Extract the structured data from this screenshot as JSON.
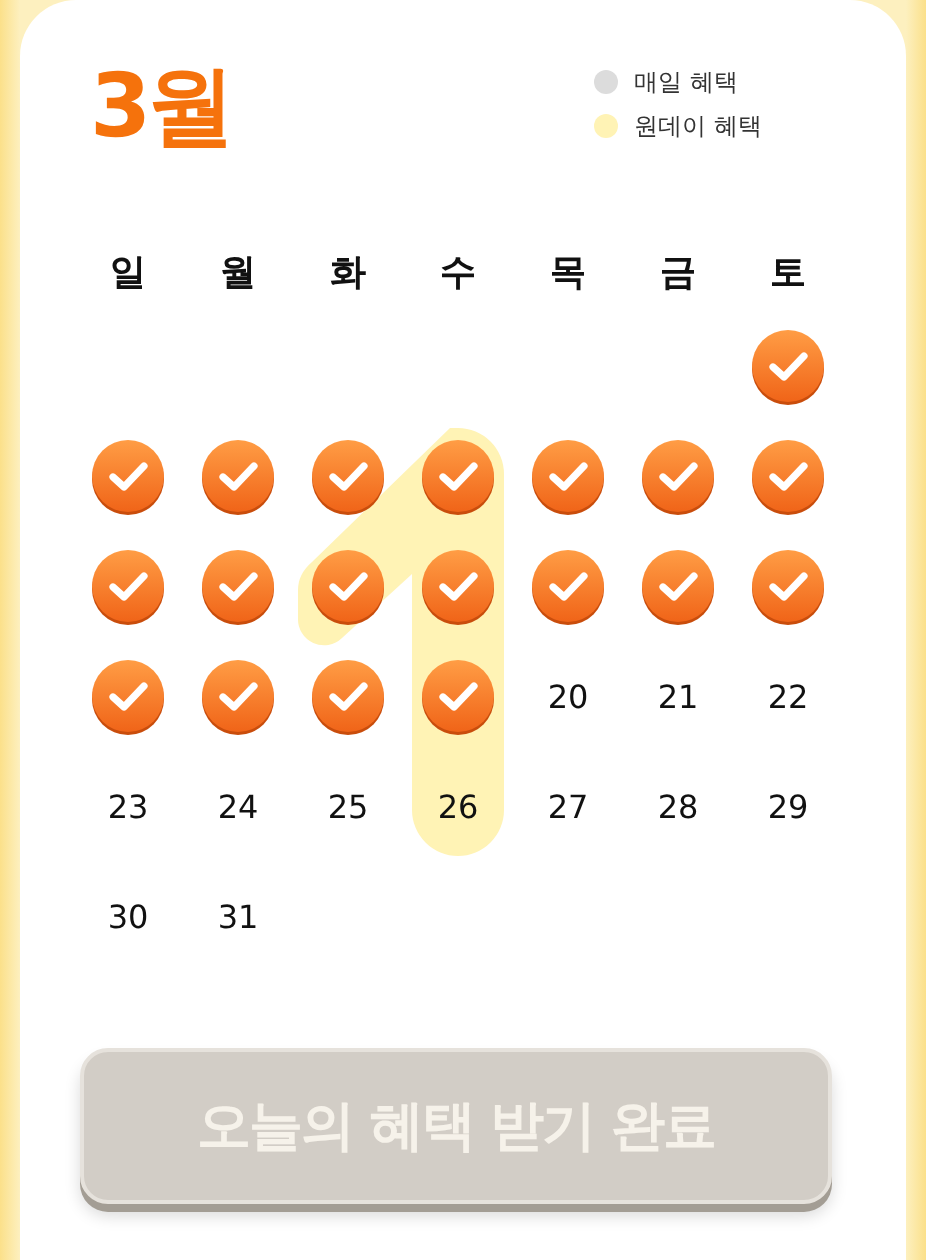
{
  "month_title": "3월",
  "legend": [
    {
      "kind": "daily",
      "label": "매일 혜택",
      "color": "#dcdcdc"
    },
    {
      "kind": "one_day",
      "label": "원데이 혜택",
      "color": "#fff3b5"
    }
  ],
  "weekdays": [
    "일",
    "월",
    "화",
    "수",
    "목",
    "금",
    "토"
  ],
  "weeks": [
    [
      {
        "kind": "blank"
      },
      {
        "kind": "blank"
      },
      {
        "kind": "blank"
      },
      {
        "kind": "blank"
      },
      {
        "kind": "blank"
      },
      {
        "kind": "blank"
      },
      {
        "kind": "day",
        "checked": true,
        "one_day": false
      }
    ],
    [
      {
        "kind": "day",
        "checked": true,
        "one_day": false
      },
      {
        "kind": "day",
        "checked": true,
        "one_day": false
      },
      {
        "kind": "day",
        "checked": true,
        "one_day": false
      },
      {
        "kind": "day",
        "checked": true,
        "one_day": true
      },
      {
        "kind": "day",
        "checked": true,
        "one_day": false
      },
      {
        "kind": "day",
        "checked": true,
        "one_day": false
      },
      {
        "kind": "day",
        "checked": true,
        "one_day": false
      }
    ],
    [
      {
        "kind": "day",
        "checked": true,
        "one_day": false
      },
      {
        "kind": "day",
        "checked": true,
        "one_day": false
      },
      {
        "kind": "day",
        "checked": true,
        "one_day": false
      },
      {
        "kind": "day",
        "checked": true,
        "one_day": true
      },
      {
        "kind": "day",
        "checked": true,
        "one_day": false
      },
      {
        "kind": "day",
        "checked": true,
        "one_day": false
      },
      {
        "kind": "day",
        "checked": true,
        "one_day": false
      }
    ],
    [
      {
        "kind": "day",
        "checked": true,
        "one_day": false
      },
      {
        "kind": "day",
        "checked": true,
        "one_day": false
      },
      {
        "kind": "day",
        "checked": true,
        "one_day": false
      },
      {
        "kind": "day",
        "checked": true,
        "one_day": true
      },
      {
        "kind": "day",
        "checked": false,
        "one_day": false,
        "label": "20"
      },
      {
        "kind": "day",
        "checked": false,
        "one_day": false,
        "label": "21"
      },
      {
        "kind": "day",
        "checked": false,
        "one_day": false,
        "label": "22"
      }
    ],
    [
      {
        "kind": "day",
        "checked": false,
        "one_day": false,
        "label": "23"
      },
      {
        "kind": "day",
        "checked": false,
        "one_day": false,
        "label": "24"
      },
      {
        "kind": "day",
        "checked": false,
        "one_day": false,
        "label": "25"
      },
      {
        "kind": "day",
        "checked": false,
        "one_day": true,
        "label": "26"
      },
      {
        "kind": "day",
        "checked": false,
        "one_day": false,
        "label": "27"
      },
      {
        "kind": "day",
        "checked": false,
        "one_day": false,
        "label": "28"
      },
      {
        "kind": "day",
        "checked": false,
        "one_day": false,
        "label": "29"
      }
    ],
    [
      {
        "kind": "day",
        "checked": false,
        "one_day": false,
        "label": "30"
      },
      {
        "kind": "day",
        "checked": false,
        "one_day": false,
        "label": "31"
      }
    ]
  ],
  "button": {
    "label": "오늘의 혜택 받기 완료",
    "disabled": true
  }
}
